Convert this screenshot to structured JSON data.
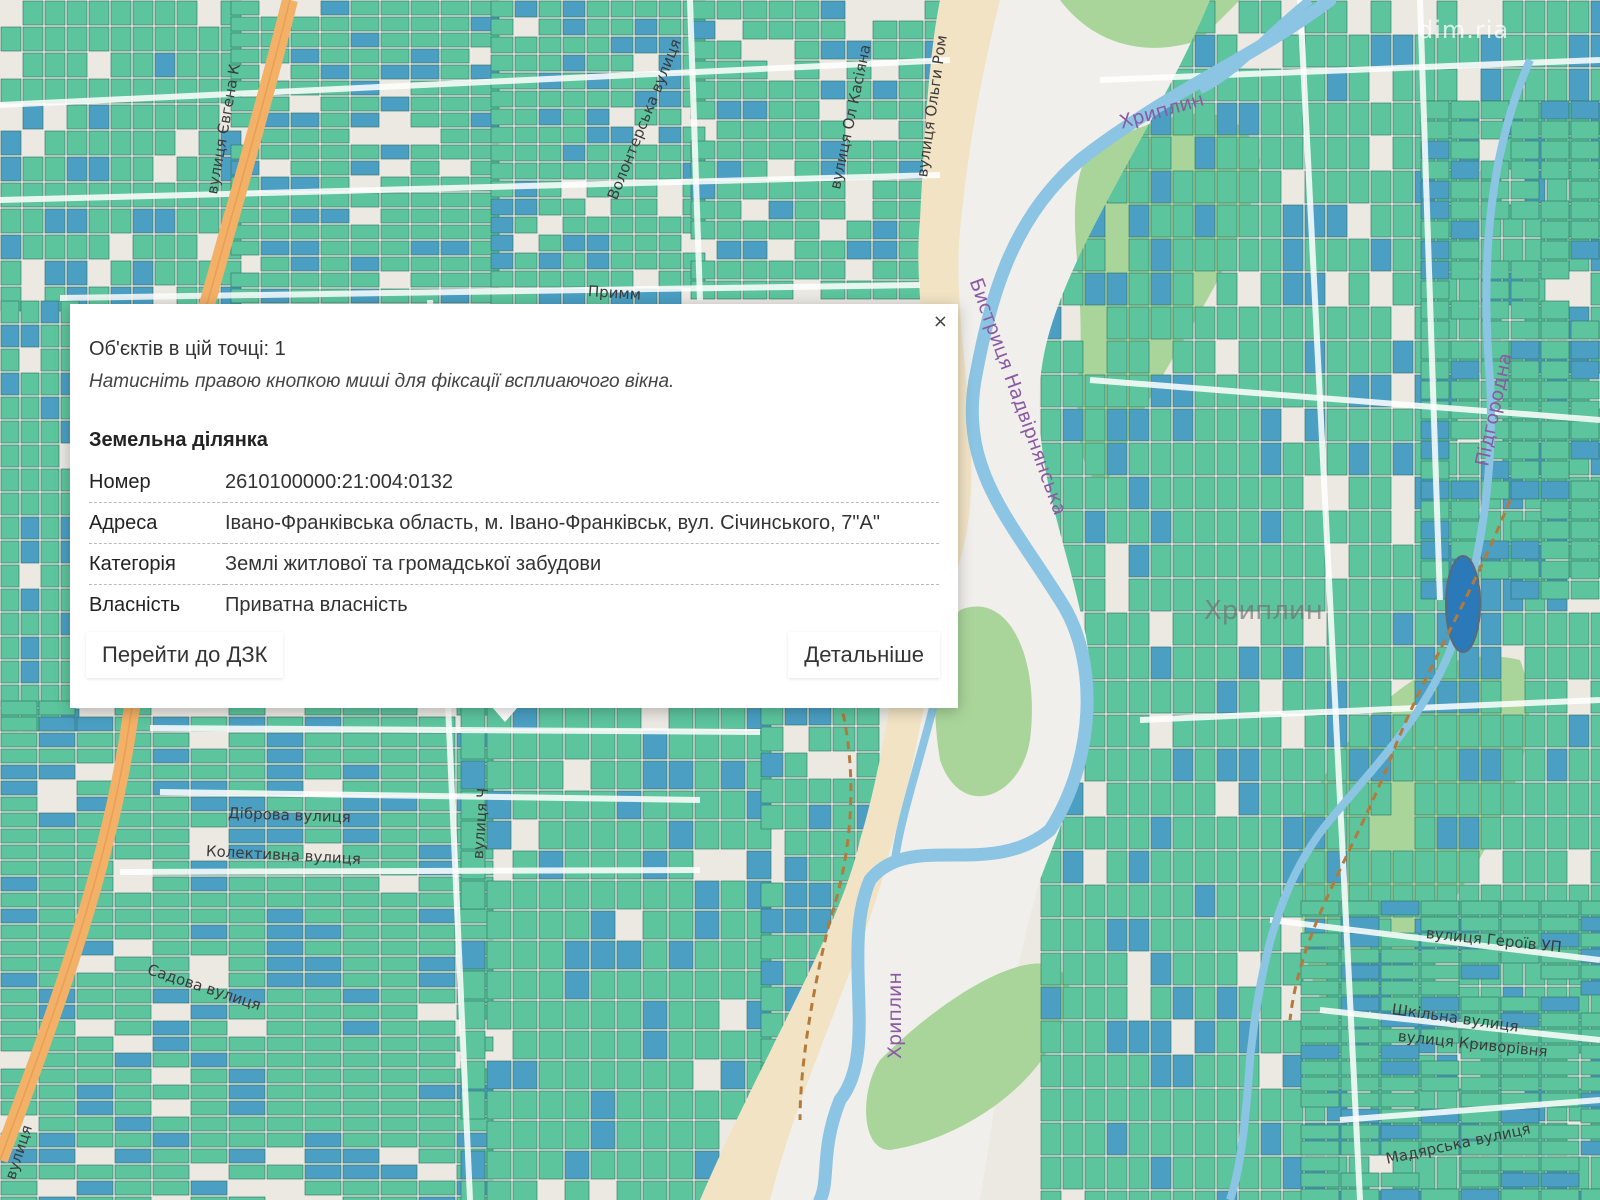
{
  "map": {
    "colors": {
      "background": "#ece9e3",
      "parcel_green": "#5cc59d",
      "parcel_blue": "#4a9fc3",
      "parcel_edge": "#2f6e62",
      "river_bank": "#f2e3c4",
      "floodplain": "#f1efeb",
      "vegetation": "#a9d59a",
      "water": "#8cc4e3",
      "main_road": "#f3b067",
      "trail": "#b37a3b"
    },
    "street_labels": {
      "yevhena_k": "вулиця Євгена К",
      "volonterska": "Волонтерська вулиця",
      "kasiiana": "вулиця Ол Касіяна",
      "olhy_romanovoi": "вулиця Ольги Ром",
      "prymm": "Примм",
      "dibrova": "Діброва вулиця",
      "kolektyvna": "Колективна вулиця",
      "vulytsia_v": "вулиця Ч",
      "sadova": "Садова вулиця",
      "heroiv": "вулиця Героїв УП",
      "shkilna": "Шкільна вулиця",
      "kryvorivnia": "вулиця Криворівня",
      "madiarska": "Мадярська вулиця",
      "bottom_left": "вулиця"
    },
    "river_labels": {
      "khryplyn_top": "Хриплин",
      "bystrytsia": "Бистриця Надвірнянська",
      "khryplyn_bottom": "Хриплин",
      "pidhorodna": "Підгородна"
    },
    "district_label": "Хриплин",
    "watermark": "dim.ria"
  },
  "popup": {
    "count_text": "Об'єктів в цій точці: 1",
    "hint_text": "Натисніть правою кнопкою миші для фіксації всплиаючого вікна.",
    "section_title": "Земельна ділянка",
    "close_label": "×",
    "rows": [
      {
        "key": "Номер",
        "value": "2610100000:21:004:0132"
      },
      {
        "key": "Адреса",
        "value": "Івано-Франківська область, м. Івано-Франківськ, вул. Січинського, 7\"А\""
      },
      {
        "key": "Категорія",
        "value": "Землі житлової та громадської забудови"
      },
      {
        "key": "Власність",
        "value": "Приватна власність"
      }
    ],
    "goto_button": "Перейти до ДЗК",
    "details_button": "Детальніше"
  }
}
